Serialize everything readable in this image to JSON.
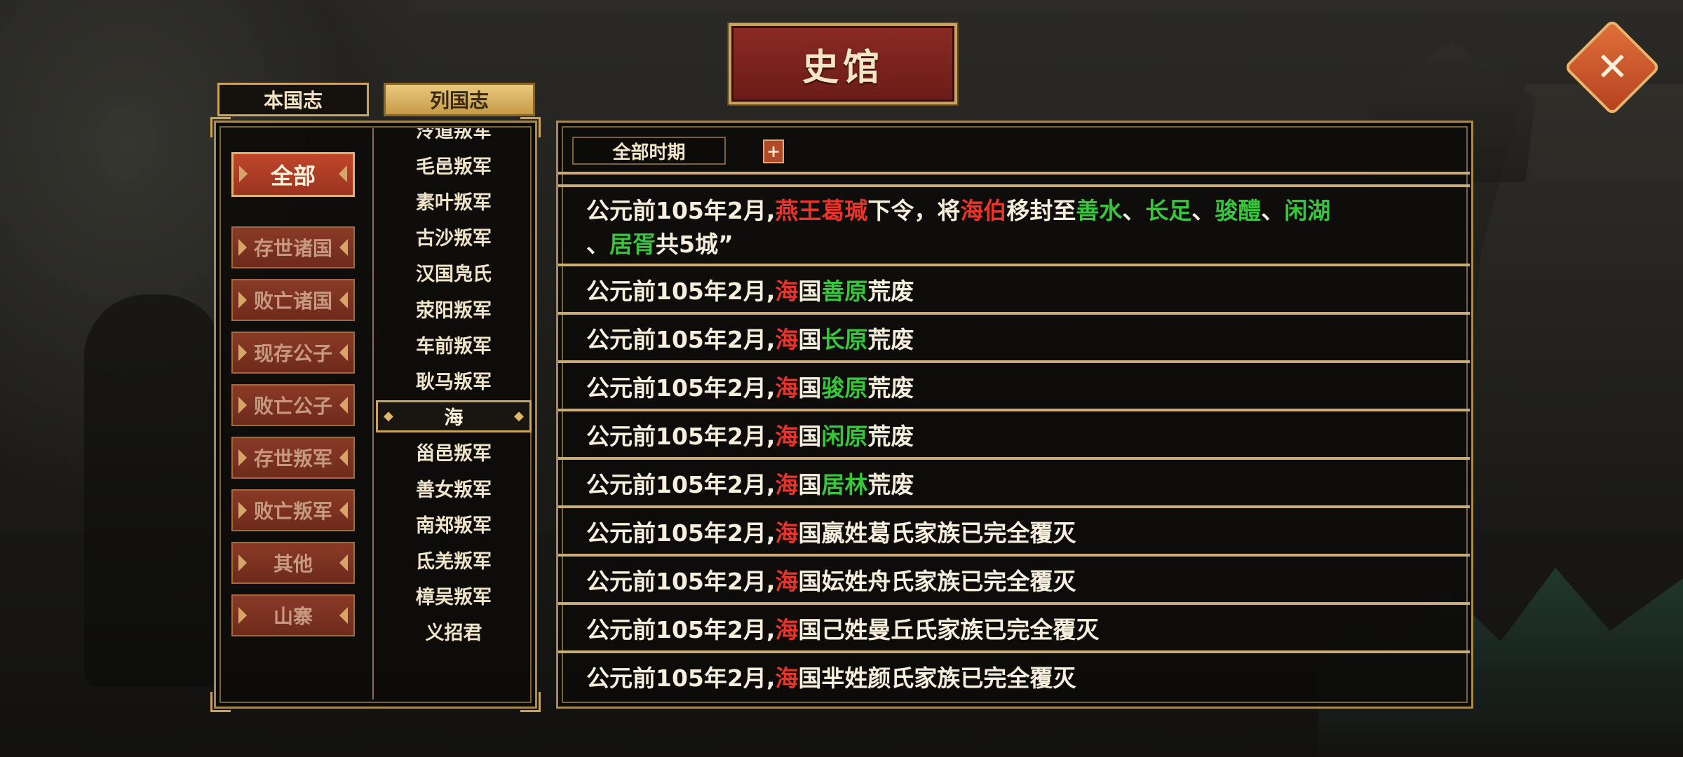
{
  "title": "史馆",
  "close_label": "✕",
  "tabs": {
    "benguo": "本国志",
    "lieguo": "列国志"
  },
  "categories": [
    {
      "label": "全部",
      "active": true
    },
    {
      "label": "存世诸国"
    },
    {
      "label": "败亡诸国"
    },
    {
      "label": "现存公子"
    },
    {
      "label": "败亡公子"
    },
    {
      "label": "存世叛军"
    },
    {
      "label": "败亡叛军"
    },
    {
      "label": "其他"
    },
    {
      "label": "山寨"
    }
  ],
  "countries": [
    "泠道叛军",
    "毛邑叛军",
    "素叶叛军",
    "古沙叛军",
    "汉国凫氏",
    "荥阳叛军",
    "车前叛军",
    "耿马叛军",
    "海",
    "甾邑叛军",
    "善女叛军",
    "南郑叛军",
    "氐羌叛军",
    "樟吴叛军",
    "义招君"
  ],
  "selected_country": "海",
  "period": {
    "label": "全部时期",
    "add_label": "+"
  },
  "colors": {
    "red": "#e8352b",
    "green": "#38c63c",
    "gold": "#c9a45a"
  },
  "log": [
    {
      "lines": [
        [
          {
            "t": "公元前105年2月",
            "c": "white"
          },
          {
            "t": ",",
            "c": "white"
          },
          {
            "t": "燕王",
            "c": "red"
          },
          {
            "t": "葛瑊",
            "c": "red"
          },
          {
            "t": "下令，将",
            "c": "white"
          },
          {
            "t": "海伯",
            "c": "red"
          },
          {
            "t": "移封至",
            "c": "white"
          },
          {
            "t": "善水",
            "c": "green"
          },
          {
            "t": "、",
            "c": "white"
          },
          {
            "t": "长足",
            "c": "green"
          },
          {
            "t": "、",
            "c": "white"
          },
          {
            "t": "骏醴",
            "c": "green"
          },
          {
            "t": "、",
            "c": "white"
          },
          {
            "t": "闲湖",
            "c": "green"
          }
        ],
        [
          {
            "t": "、",
            "c": "white"
          },
          {
            "t": "居胥",
            "c": "green"
          },
          {
            "t": "共5城”",
            "c": "white"
          }
        ]
      ]
    },
    {
      "lines": [
        [
          {
            "t": "公元前105年2月",
            "c": "white"
          },
          {
            "t": ",",
            "c": "white"
          },
          {
            "t": "海",
            "c": "red"
          },
          {
            "t": "国",
            "c": "white"
          },
          {
            "t": "善原",
            "c": "green"
          },
          {
            "t": "荒废",
            "c": "white"
          }
        ]
      ]
    },
    {
      "lines": [
        [
          {
            "t": "公元前105年2月",
            "c": "white"
          },
          {
            "t": ",",
            "c": "white"
          },
          {
            "t": "海",
            "c": "red"
          },
          {
            "t": "国",
            "c": "white"
          },
          {
            "t": "长原",
            "c": "green"
          },
          {
            "t": "荒废",
            "c": "white"
          }
        ]
      ]
    },
    {
      "lines": [
        [
          {
            "t": "公元前105年2月",
            "c": "white"
          },
          {
            "t": ",",
            "c": "white"
          },
          {
            "t": "海",
            "c": "red"
          },
          {
            "t": "国",
            "c": "white"
          },
          {
            "t": "骏原",
            "c": "green"
          },
          {
            "t": "荒废",
            "c": "white"
          }
        ]
      ]
    },
    {
      "lines": [
        [
          {
            "t": "公元前105年2月",
            "c": "white"
          },
          {
            "t": ",",
            "c": "white"
          },
          {
            "t": "海",
            "c": "red"
          },
          {
            "t": "国",
            "c": "white"
          },
          {
            "t": "闲原",
            "c": "green"
          },
          {
            "t": "荒废",
            "c": "white"
          }
        ]
      ]
    },
    {
      "lines": [
        [
          {
            "t": "公元前105年2月",
            "c": "white"
          },
          {
            "t": ",",
            "c": "white"
          },
          {
            "t": "海",
            "c": "red"
          },
          {
            "t": "国",
            "c": "white"
          },
          {
            "t": "居林",
            "c": "green"
          },
          {
            "t": "荒废",
            "c": "white"
          }
        ]
      ]
    },
    {
      "lines": [
        [
          {
            "t": "公元前105年2月",
            "c": "white"
          },
          {
            "t": ",",
            "c": "white"
          },
          {
            "t": "海",
            "c": "red"
          },
          {
            "t": "国嬴姓葛氏家族已完全覆灭",
            "c": "white"
          }
        ]
      ]
    },
    {
      "lines": [
        [
          {
            "t": "公元前105年2月",
            "c": "white"
          },
          {
            "t": ",",
            "c": "white"
          },
          {
            "t": "海",
            "c": "red"
          },
          {
            "t": "国妘姓舟氏家族已完全覆灭",
            "c": "white"
          }
        ]
      ]
    },
    {
      "lines": [
        [
          {
            "t": "公元前105年2月",
            "c": "white"
          },
          {
            "t": ",",
            "c": "white"
          },
          {
            "t": "海",
            "c": "red"
          },
          {
            "t": "国己姓曼丘氏家族已完全覆灭",
            "c": "white"
          }
        ]
      ]
    },
    {
      "lines": [
        [
          {
            "t": "公元前105年2月",
            "c": "white"
          },
          {
            "t": ",",
            "c": "white"
          },
          {
            "t": "海",
            "c": "red"
          },
          {
            "t": "国芈姓颜氏家族已完全覆灭",
            "c": "white"
          }
        ]
      ]
    }
  ]
}
